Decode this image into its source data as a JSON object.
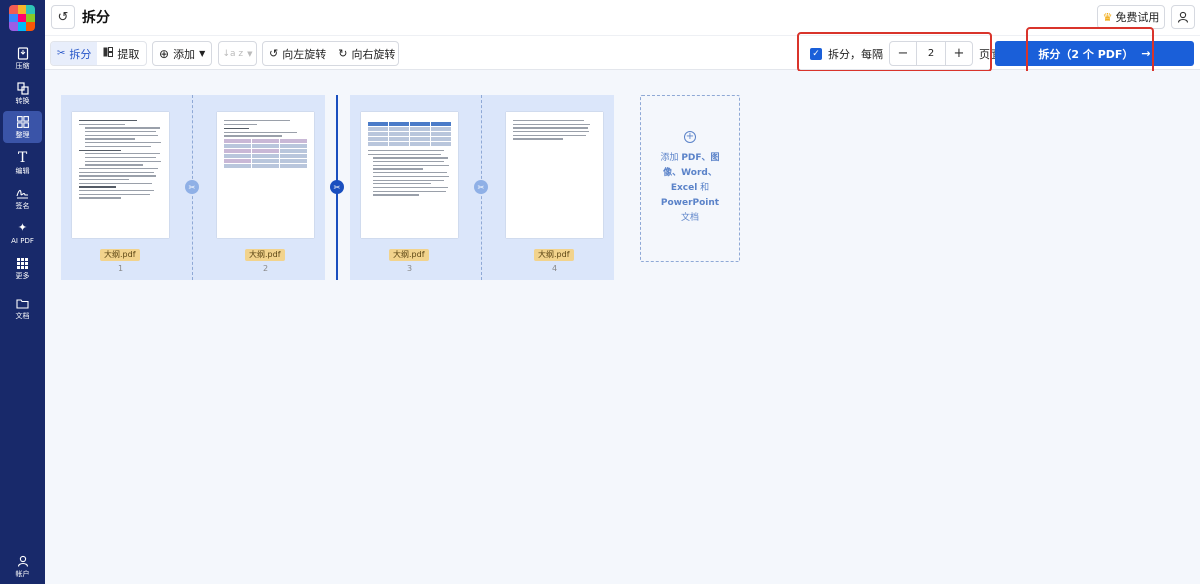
{
  "sidebar": {
    "items": [
      {
        "label": "压缩",
        "icon": "compress-icon"
      },
      {
        "label": "转换",
        "icon": "convert-icon"
      },
      {
        "label": "整理",
        "icon": "organize-icon"
      },
      {
        "label": "编辑",
        "icon": "edit-text-icon"
      },
      {
        "label": "签名",
        "icon": "signature-icon"
      },
      {
        "label": "AI PDF",
        "icon": "ai-sparkle-icon"
      },
      {
        "label": "更多",
        "icon": "grid-more-icon"
      },
      {
        "label": "文档",
        "icon": "folder-icon"
      }
    ],
    "account": {
      "label": "帐户",
      "icon": "user-icon"
    }
  },
  "header": {
    "title": "拆分",
    "trial_label": "免费试用"
  },
  "toolbar": {
    "split_label": "拆分",
    "extract_label": "提取",
    "add_label": "添加",
    "sort_label": "↓a z",
    "rotate_left_label": "向左旋转",
    "rotate_right_label": "向右旋转",
    "split_every_label": "拆分，每隔",
    "interval_value": "2",
    "pages_suffix": "页面",
    "primary_label": "拆分（2 个 PDF）",
    "primary_arrow": "→"
  },
  "pages": [
    {
      "file": "大纲.pdf",
      "num": "1"
    },
    {
      "file": "大纲.pdf",
      "num": "2"
    },
    {
      "file": "大纲.pdf",
      "num": "3"
    },
    {
      "file": "大纲.pdf",
      "num": "4"
    }
  ],
  "add_box": {
    "line1_a": "添加 ",
    "line1_b": "PDF",
    "line1_c": "、图",
    "line2": "像、Word、",
    "line3_a": "Excel",
    "line3_b": " 和",
    "line4": "PowerPoint",
    "line5": "文档"
  },
  "colors": {
    "sidebar_bg": "#18296a",
    "primary": "#1a5fd9",
    "highlight": "#d9342b",
    "group_bg": "#dbe6fa"
  }
}
